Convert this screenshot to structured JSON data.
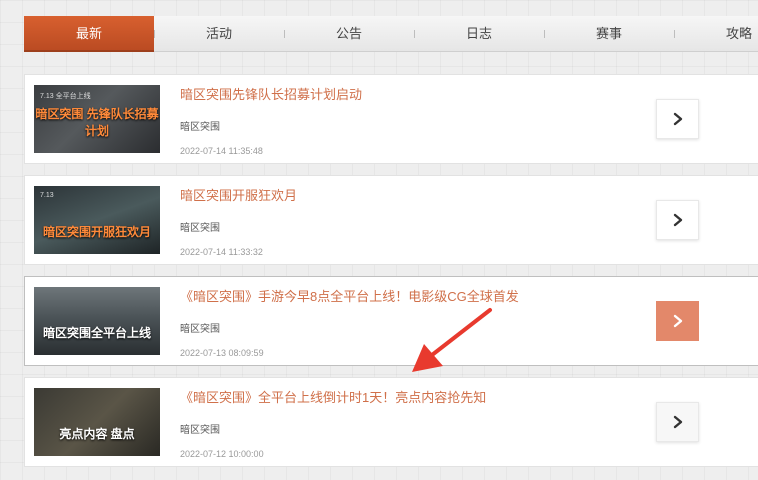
{
  "tabs": [
    {
      "label": "最新",
      "active": true
    },
    {
      "label": "活动",
      "active": false
    },
    {
      "label": "公告",
      "active": false
    },
    {
      "label": "日志",
      "active": false
    },
    {
      "label": "赛事",
      "active": false
    },
    {
      "label": "攻略",
      "active": false
    }
  ],
  "news": [
    {
      "title": "暗区突围先锋队长招募计划启动",
      "source": "暗区突围",
      "date": "2022-07-14 11:35:48",
      "thumb_text": "暗区突围 先锋队长招募计划",
      "thumb_logo": "7.13 全平台上线"
    },
    {
      "title": "暗区突围开服狂欢月",
      "source": "暗区突围",
      "date": "2022-07-14 11:33:32",
      "thumb_text": "暗区突围开服狂欢月",
      "thumb_logo": "7.13"
    },
    {
      "title": "《暗区突围》手游今早8点全平台上线！电影级CG全球首发",
      "source": "暗区突围",
      "date": "2022-07-13 08:09:59",
      "thumb_text": "暗区突围全平台上线",
      "thumb_logo": ""
    },
    {
      "title": "《暗区突围》全平台上线倒计时1天！亮点内容抢先知",
      "source": "暗区突围",
      "date": "2022-07-12 10:00:00",
      "thumb_text": "亮点内容 盘点",
      "thumb_logo": ""
    }
  ],
  "colors": {
    "accent": "#c95428",
    "title": "#d0704a",
    "active_arrow_bg": "#e3886a",
    "annotation": "#e83a2e"
  },
  "icons": {
    "arrow": "chevron-right-icon",
    "annotation": "red-pointer-arrow"
  }
}
